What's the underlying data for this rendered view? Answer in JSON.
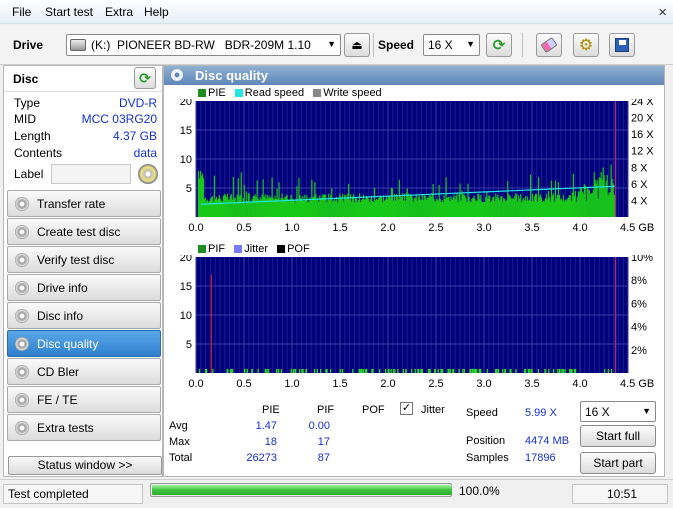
{
  "menu": {
    "items": [
      "File",
      "Start test",
      "Extra",
      "Help"
    ]
  },
  "toolbar": {
    "drive_label": "Drive",
    "drive_value": "(K:)  PIONEER BD-RW   BDR-209M 1.10",
    "speed_label": "Speed",
    "speed_value": "16 X"
  },
  "disc": {
    "header": "Disc",
    "rows": [
      {
        "key": "Type",
        "value": "DVD-R"
      },
      {
        "key": "MID",
        "value": "MCC 03RG20"
      },
      {
        "key": "Length",
        "value": "4.37 GB"
      },
      {
        "key": "Contents",
        "value": "data"
      }
    ],
    "label_key": "Label",
    "label_value": ""
  },
  "nav": {
    "items": [
      "Transfer rate",
      "Create test disc",
      "Verify test disc",
      "Drive info",
      "Disc info",
      "Disc quality",
      "CD Bler",
      "FE / TE",
      "Extra tests"
    ],
    "active": "Disc quality",
    "status_window": "Status window >>"
  },
  "panel": {
    "title": "Disc quality"
  },
  "chart_data": [
    {
      "type": "area",
      "legend": [
        "PIE",
        "Read speed",
        "Write speed"
      ],
      "legend_colors": [
        "#1e8c1e",
        "#22e6e6",
        "#888888"
      ],
      "x_ticks": [
        "0.0",
        "0.5",
        "1.0",
        "1.5",
        "2.0",
        "2.5",
        "3.0",
        "3.5",
        "4.0",
        "4.5 GB"
      ],
      "y_left_ticks": [
        "5",
        "10",
        "15",
        "20"
      ],
      "y_right_ticks": [
        "4 X",
        "6 X",
        "8 X",
        "12 X",
        "16 X",
        "20 X",
        "24 X"
      ],
      "xlim": [
        0,
        4.5
      ],
      "ylim": [
        0,
        20
      ],
      "pie_baseline": 2.5,
      "read_speed_start": 2.2,
      "read_speed_end": 5.3
    },
    {
      "type": "bar",
      "legend": [
        "PIF",
        "Jitter",
        "POF"
      ],
      "legend_colors": [
        "#1e8c1e",
        "#7a7aff",
        "#000000"
      ],
      "x_ticks": [
        "0.0",
        "0.5",
        "1.0",
        "1.5",
        "2.0",
        "2.5",
        "3.0",
        "3.5",
        "4.0",
        "4.5 GB"
      ],
      "y_left_ticks": [
        "5",
        "10",
        "15",
        "20"
      ],
      "y_right_ticks": [
        "2%",
        "4%",
        "6%",
        "8%",
        "10%"
      ],
      "xlim": [
        0,
        4.5
      ],
      "ylim": [
        0,
        20
      ]
    }
  ],
  "stats": {
    "headers": {
      "pie": "PIE",
      "pif": "PIF",
      "pof": "POF",
      "jitter": "Jitter"
    },
    "avg_label": "Avg",
    "avg_pie": "1.47",
    "avg_pif": "0.00",
    "max_label": "Max",
    "max_pie": "18",
    "max_pif": "17",
    "total_label": "Total",
    "total_pie": "26273",
    "total_pif": "87",
    "speed_label": "Speed",
    "speed_value": "5.99 X",
    "position_label": "Position",
    "position_value": "4474 MB",
    "samples_label": "Samples",
    "samples_value": "17896",
    "speed_select": "16 X",
    "start_full": "Start full",
    "start_part": "Start part"
  },
  "status": {
    "text": "Test completed",
    "progress": 1.0,
    "progress_text": "100.0%",
    "time": "10:51"
  }
}
